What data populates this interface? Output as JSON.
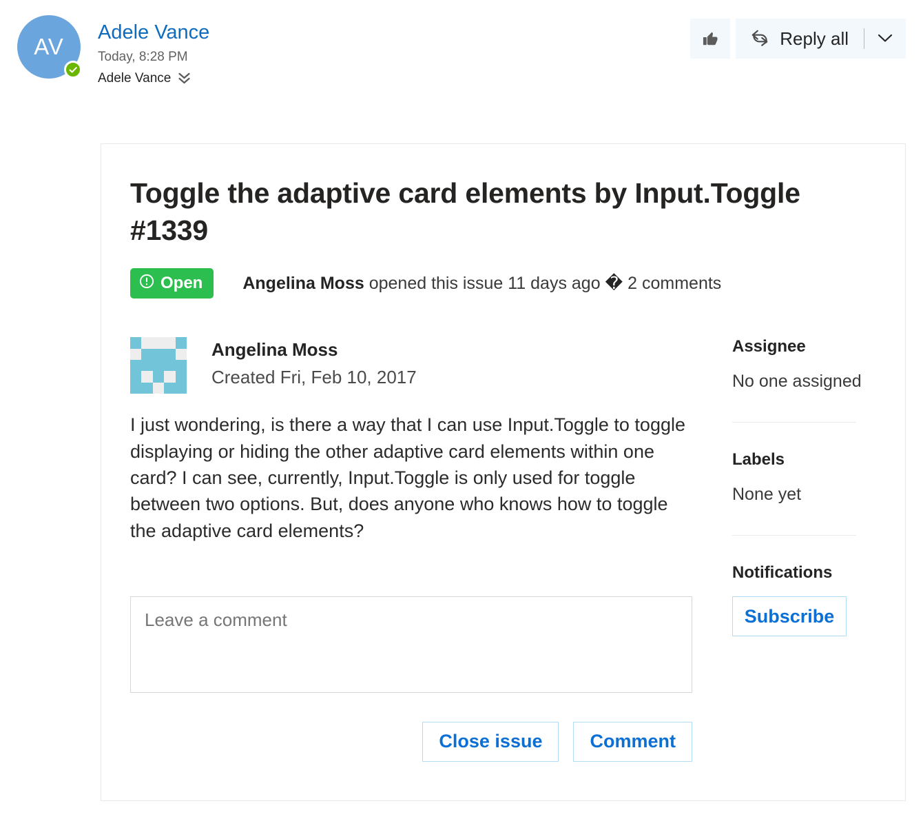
{
  "mail": {
    "sender_initials": "AV",
    "sender_name": "Adele Vance",
    "sent_time": "Today, 8:28 PM",
    "recipient": "Adele Vance",
    "presence_icon": "available-check-icon",
    "expand_icon": "double-chevron-down-icon",
    "actions": {
      "like_icon": "thumbs-up-icon",
      "reply_all_icon": "reply-all-arrows-icon",
      "reply_all_label": "Reply all",
      "dropdown_icon": "chevron-down-icon"
    }
  },
  "issue": {
    "title": "Toggle the adaptive card elements by Input.Toggle #1339",
    "state": {
      "label": "Open",
      "icon": "exclamation-circle-icon",
      "color": "#2cbe4e"
    },
    "meta": {
      "author": "Angelina Moss",
      "action_text": " opened this issue 11 days ago ",
      "separator_glyph": "�",
      "comment_count": " 2 comments"
    },
    "comment": {
      "avatar_icon": "identicon-avatar",
      "author": "Angelina Moss",
      "created": "Created Fri, Feb 10, 2017",
      "body": "I just wondering, is there a way that I can use Input.Toggle to toggle displaying or hiding the other adaptive card elements within one card? I can see, currently, Input.Toggle is only used for toggle between two options. But, does anyone who knows how to toggle the adaptive card elements?"
    },
    "compose": {
      "placeholder": "Leave a comment",
      "value": ""
    },
    "buttons": {
      "close_issue": "Close issue",
      "comment": "Comment"
    },
    "sidebar": {
      "assignee_title": "Assignee",
      "assignee_value": "No one assigned",
      "labels_title": "Labels",
      "labels_value": "None yet",
      "notifications_title": "Notifications",
      "subscribe_label": "Subscribe"
    }
  }
}
